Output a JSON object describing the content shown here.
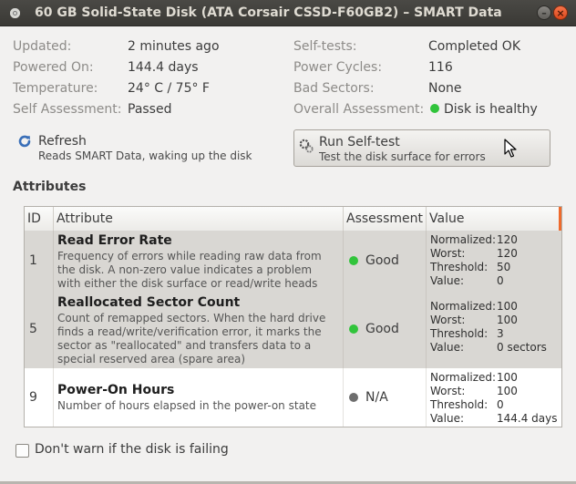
{
  "window": {
    "title": "60 GB Solid-State Disk (ATA Corsair CSSD-F60GB2) – SMART Data",
    "minimize_glyph": "–",
    "close_glyph": "×"
  },
  "info_left": [
    {
      "label": "Updated:",
      "value": "2 minutes ago"
    },
    {
      "label": "Powered On:",
      "value": "144.4 days"
    },
    {
      "label": "Temperature:",
      "value": "24° C / 75° F"
    },
    {
      "label": "Self Assessment:",
      "value": "Passed"
    }
  ],
  "info_right": [
    {
      "label": "Self-tests:",
      "value": "Completed OK"
    },
    {
      "label": "Power Cycles:",
      "value": "116"
    },
    {
      "label": "Bad Sectors:",
      "value": "None"
    },
    {
      "label": "Overall Assessment:",
      "value": "Disk is healthy",
      "status_color": "#31c43b"
    }
  ],
  "refresh": {
    "title": "Refresh",
    "subtitle": "Reads SMART Data, waking up the disk",
    "icon": "refresh-icon"
  },
  "self_test": {
    "title": "Run Self-test",
    "subtitle": "Test the disk surface for errors",
    "icon": "self-test-icon"
  },
  "attributes": {
    "heading": "Attributes",
    "columns": [
      "ID",
      "Attribute",
      "Assessment",
      "Value"
    ],
    "rows": [
      {
        "id": "1",
        "name": "Read Error Rate",
        "description": "Frequency of errors while reading raw data from the disk. A non-zero value indicates a problem with either the disk surface or read/write heads",
        "assessment": "Good",
        "assessment_color": "#31c43b",
        "normalized_label": "Normalized:",
        "normalized": "120",
        "worst_label": "Worst:",
        "worst": "120",
        "threshold_label": "Threshold:",
        "threshold": "50",
        "value_label": "Value:",
        "value": "0",
        "selected": true
      },
      {
        "id": "5",
        "name": "Reallocated Sector Count",
        "description": "Count of remapped sectors. When the hard drive finds a read/write/verification error, it marks the sector as \"reallocated\" and transfers data to a special reserved area (spare area)",
        "assessment": "Good",
        "assessment_color": "#31c43b",
        "normalized_label": "Normalized:",
        "normalized": "100",
        "worst_label": "Worst:",
        "worst": "100",
        "threshold_label": "Threshold:",
        "threshold": "3",
        "value_label": "Value:",
        "value": "0 sectors",
        "selected": true
      },
      {
        "id": "9",
        "name": "Power-On Hours",
        "description": "Number of hours elapsed in the power-on state",
        "assessment": "N/A",
        "assessment_color": "#6e6e6e",
        "normalized_label": "Normalized:",
        "normalized": "100",
        "worst_label": "Worst:",
        "worst": "100",
        "threshold_label": "Threshold:",
        "threshold": "0",
        "value_label": "Value:",
        "value": "144.4 days",
        "selected": false
      }
    ]
  },
  "footer": {
    "checkbox_label": "Don't warn if the disk is failing",
    "checked": false
  }
}
